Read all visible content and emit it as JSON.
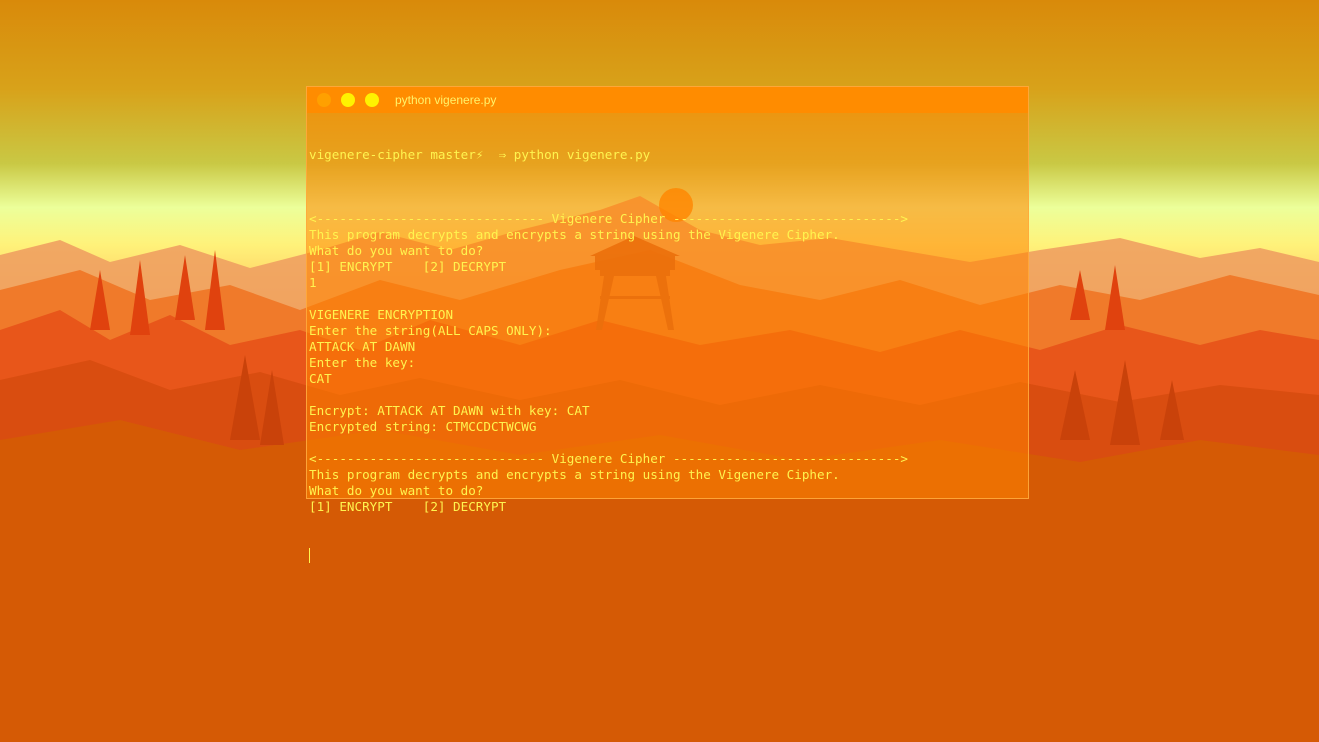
{
  "window": {
    "title": "python vigenere.py",
    "controls": {
      "close": "close",
      "minimize": "minimize",
      "maximize": "maximize"
    }
  },
  "terminal": {
    "prompt": {
      "directory": "vigenere-cipher",
      "branch": "master⚡",
      "arrow": "⇒",
      "command": "python vigenere.py"
    },
    "lines": [
      "",
      "<------------------------------ Vigenere Cipher ------------------------------>",
      "This program decrypts and encrypts a string using the Vigenere Cipher.",
      "What do you want to do?",
      "[1] ENCRYPT    [2] DECRYPT",
      "1",
      "",
      "VIGENERE ENCRYPTION",
      "Enter the string(ALL CAPS ONLY):",
      "ATTACK AT DAWN",
      "Enter the key:",
      "CAT",
      "",
      "Encrypt: ATTACK AT DAWN with key: CAT",
      "Encrypted string: CTMCCDCTWCWG",
      "",
      "<------------------------------ Vigenere Cipher ------------------------------>",
      "This program decrypts and encrypts a string using the Vigenere Cipher.",
      "What do you want to do?",
      "[1] ENCRYPT    [2] DECRYPT"
    ]
  },
  "colors": {
    "terminal_text": "#fff44f",
    "titlebar": "#ff8c00",
    "desktop_base": "#d15f00"
  },
  "icons": {
    "close": "circle",
    "minimize": "circle",
    "maximize": "circle"
  }
}
